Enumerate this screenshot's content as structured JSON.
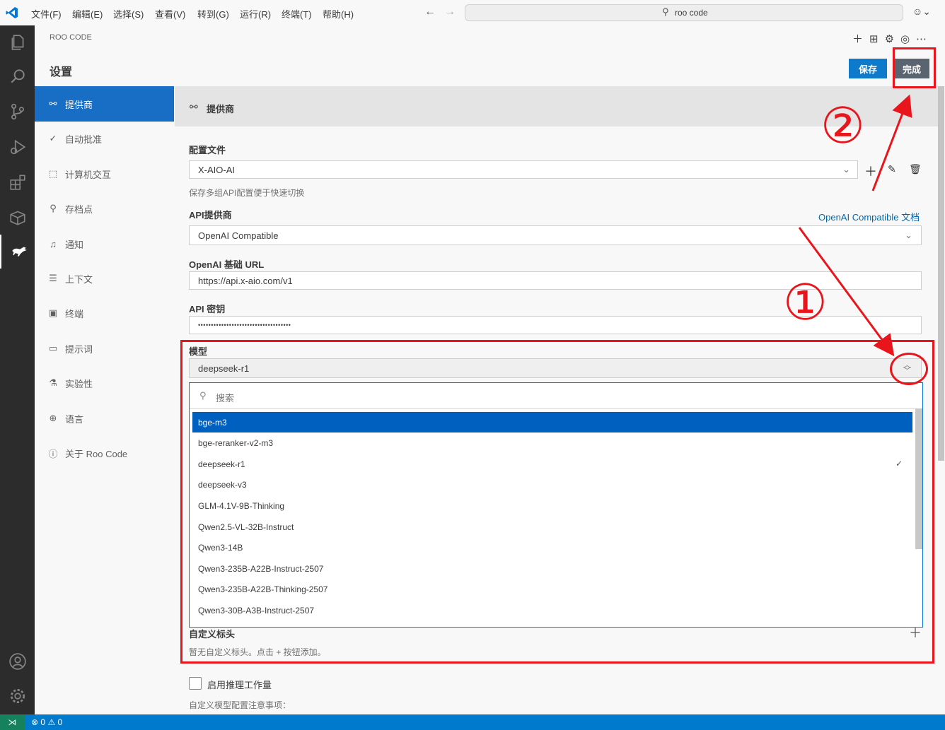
{
  "titlebar": {
    "menu": [
      "文件(F)",
      "编辑(E)",
      "选择(S)",
      "查看(V)",
      "转到(G)",
      "运行(R)",
      "终端(T)",
      "帮助(H)"
    ],
    "search_text": "roo code"
  },
  "panel": {
    "header": "ROO CODE",
    "settings_title": "设置",
    "save_label": "保存",
    "done_label": "完成"
  },
  "nav": [
    {
      "label": "提供商",
      "icon": "webhook-icon"
    },
    {
      "label": "自动批准",
      "icon": "check-all-icon"
    },
    {
      "label": "计算机交互",
      "icon": "pointer-icon"
    },
    {
      "label": "存档点",
      "icon": "git-commit-icon"
    },
    {
      "label": "通知",
      "icon": "bell-icon"
    },
    {
      "label": "上下文",
      "icon": "database-icon"
    },
    {
      "label": "终端",
      "icon": "terminal-icon"
    },
    {
      "label": "提示词",
      "icon": "comment-icon"
    },
    {
      "label": "实验性",
      "icon": "flask-icon"
    },
    {
      "label": "语言",
      "icon": "globe-icon"
    },
    {
      "label": "关于 Roo Code",
      "icon": "info-icon"
    }
  ],
  "section": {
    "title": "提供商",
    "config_label": "配置文件",
    "config_value": "X-AIO-AI",
    "config_hint": "保存多组API配置便于快速切换",
    "api_provider_label": "API提供商",
    "api_provider_doc_link": "OpenAI Compatible 文档",
    "api_provider_value": "OpenAI Compatible",
    "base_url_label": "OpenAI 基础 URL",
    "base_url_value": "https://api.x-aio.com/v1",
    "api_key_label": "API 密钥",
    "api_key_value": "••••••••••••••••••••••••••••••••••••",
    "model_label": "模型",
    "model_value": "deepseek-r1",
    "search_placeholder": "搜索",
    "custom_headers_label": "自定义标头",
    "custom_headers_hint": "暂无自定义标头。点击 + 按钮添加。",
    "reasoning_checkbox_label": "启用推理工作量",
    "custom_model_note": "自定义模型配置注意事项："
  },
  "model_options": [
    {
      "label": "bge-m3",
      "selected": true,
      "checked": false
    },
    {
      "label": "bge-reranker-v2-m3",
      "selected": false,
      "checked": false
    },
    {
      "label": "deepseek-r1",
      "selected": false,
      "checked": true
    },
    {
      "label": "deepseek-v3",
      "selected": false,
      "checked": false
    },
    {
      "label": "GLM-4.1V-9B-Thinking",
      "selected": false,
      "checked": false
    },
    {
      "label": "Qwen2.5-VL-32B-Instruct",
      "selected": false,
      "checked": false
    },
    {
      "label": "Qwen3-14B",
      "selected": false,
      "checked": false
    },
    {
      "label": "Qwen3-235B-A22B-Instruct-2507",
      "selected": false,
      "checked": false
    },
    {
      "label": "Qwen3-235B-A22B-Thinking-2507",
      "selected": false,
      "checked": false
    },
    {
      "label": "Qwen3-30B-A3B-Instruct-2507",
      "selected": false,
      "checked": false
    }
  ],
  "annotations": {
    "step1": "①",
    "step2": "②"
  },
  "statusbar": {
    "errors": "0",
    "warnings": "0"
  },
  "colors": {
    "accent": "#007acc",
    "primary_button": "#0e7acc",
    "done_button": "#5a6470",
    "annotation_red": "#e8161c",
    "selected_item": "#0060c0"
  }
}
